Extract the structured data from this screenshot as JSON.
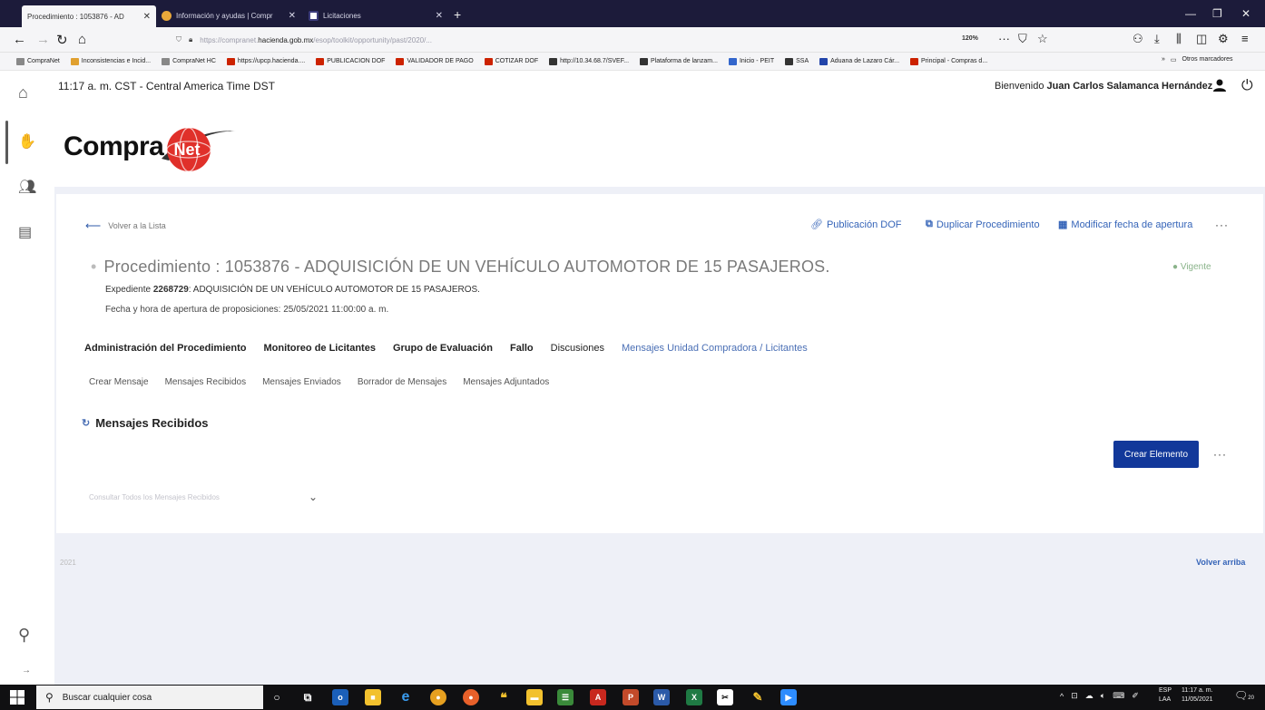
{
  "browser": {
    "tabs": [
      {
        "title": "Procedimiento : 1053876 - AD",
        "active": true
      },
      {
        "title": "Información y ayudas | Compr",
        "active": false
      },
      {
        "title": "Licitaciones",
        "active": false
      }
    ],
    "new_tab": "+",
    "url_prefix": "https://compranet.",
    "url_host": "hacienda.gob.mx",
    "url_rest": "/esop/toolkit/opportunity/past/2020/...",
    "zoom": "120%",
    "bookmarks": [
      {
        "label": "CompraNet",
        "color": "#888888"
      },
      {
        "label": "Inconsistencias e Incid...",
        "color": "#e0a030"
      },
      {
        "label": "CompraNet HC",
        "color": "#888888"
      },
      {
        "label": "https://upcp.hacienda....",
        "color": "#cc2200"
      },
      {
        "label": "PUBLICACION DOF",
        "color": "#cc2200"
      },
      {
        "label": "VALIDADOR DE PAGO",
        "color": "#cc2200"
      },
      {
        "label": "COTIZAR DOF",
        "color": "#cc2200"
      },
      {
        "label": "http://10.34.68.7/SVEF...",
        "color": "#333333"
      },
      {
        "label": "Plataforma de lanzam...",
        "color": "#333333"
      },
      {
        "label": "Inicio - PEIT",
        "color": "#3366cc"
      },
      {
        "label": "SSA",
        "color": "#333333"
      },
      {
        "label": "Aduana de Lazaro Cár...",
        "color": "#2244aa"
      },
      {
        "label": "Principal - Compras d...",
        "color": "#cc2200"
      }
    ],
    "bookmarks_more": "»",
    "other_bookmarks": "Otros marcadores"
  },
  "header": {
    "clock": "11:17 a. m. CST - Central America Time DST",
    "welcome_prefix": "Bienvenido",
    "user_name": "Juan Carlos Salamanca Hernández"
  },
  "logo": {
    "text": "Compra",
    "ball_text": "Net"
  },
  "toolbar": {
    "back": "Volver a la Lista",
    "publicacion": "Publicación DOF",
    "duplicar": "Duplicar Procedimiento",
    "modificar": "Modificar fecha de apertura",
    "more": "···"
  },
  "procedure": {
    "title": "Procedimiento : 1053876 - ADQUISICIÓN DE UN VEHÍCULO AUTOMOTOR DE 15 PASAJEROS.",
    "status": "Vigente",
    "expediente_label": "Expediente",
    "expediente_num": "2268729",
    "expediente_desc": ": ADQUISICIÓN DE UN VEHÍCULO AUTOMOTOR DE 15 PASAJEROS.",
    "fecha": "Fecha y hora de apertura de proposiciones: 25/05/2021 11:00:00 a. m."
  },
  "main_nav": [
    {
      "label": "Administración del Procedimiento",
      "bold": true
    },
    {
      "label": "Monitoreo de Licitantes",
      "bold": true
    },
    {
      "label": "Grupo de Evaluación",
      "bold": true
    },
    {
      "label": "Fallo",
      "bold": true
    },
    {
      "label": "Discusiones",
      "bold": false
    },
    {
      "label": "Mensajes Unidad Compradora / Licitantes",
      "active": true
    }
  ],
  "sub_nav": [
    "Crear Mensaje",
    "Mensajes Recibidos",
    "Mensajes Enviados",
    "Borrador de Mensajes",
    "Mensajes Adjuntados"
  ],
  "section": {
    "title": "Mensajes Recibidos",
    "create_button": "Crear Elemento",
    "more": "···",
    "filter_placeholder": "Consultar Todos los Mensajes Recibidos"
  },
  "footer": {
    "year": "2021",
    "back_to_top": "Volver arriba"
  },
  "taskbar": {
    "search": "Buscar cualquier cosa",
    "lang1": "ESP",
    "lang2": "LAA",
    "time": "11:17 a. m.",
    "date": "11/05/2021",
    "notif_count": "20"
  }
}
